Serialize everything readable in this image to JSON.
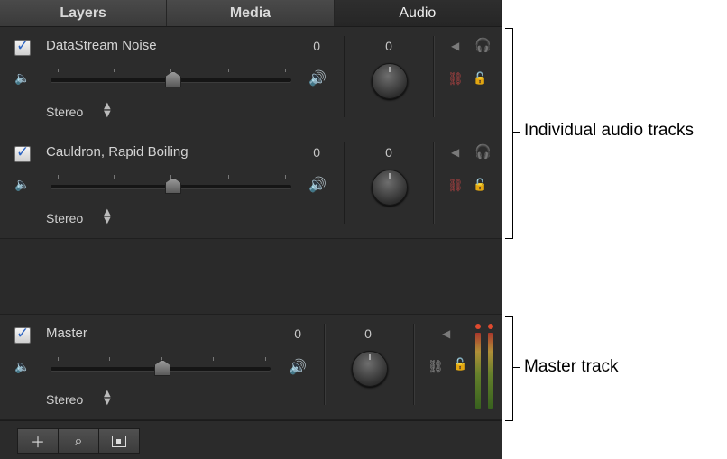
{
  "tabs": [
    {
      "label": "Layers"
    },
    {
      "label": "Media"
    },
    {
      "label": "Audio",
      "active": true
    }
  ],
  "tracks": [
    {
      "name": "DataStream Noise",
      "level": "0",
      "pan": "0",
      "format": "Stereo",
      "enabled": true
    },
    {
      "name": "Cauldron, Rapid Boiling",
      "level": "0",
      "pan": "0",
      "format": "Stereo",
      "enabled": true
    }
  ],
  "master": {
    "name": "Master",
    "level": "0",
    "pan": "0",
    "format": "Stereo",
    "enabled": true
  },
  "toolbar": {
    "add_icon": "plus-icon",
    "search_icon": "magnifier-icon",
    "view_icon": "window-icon"
  },
  "callouts": {
    "individual": "Individual audio tracks",
    "master": "Master track"
  },
  "colors": {
    "solo": "#d19a2c",
    "checkbox_check": "#2b63c2",
    "panel_bg": "#2b2b2b"
  }
}
